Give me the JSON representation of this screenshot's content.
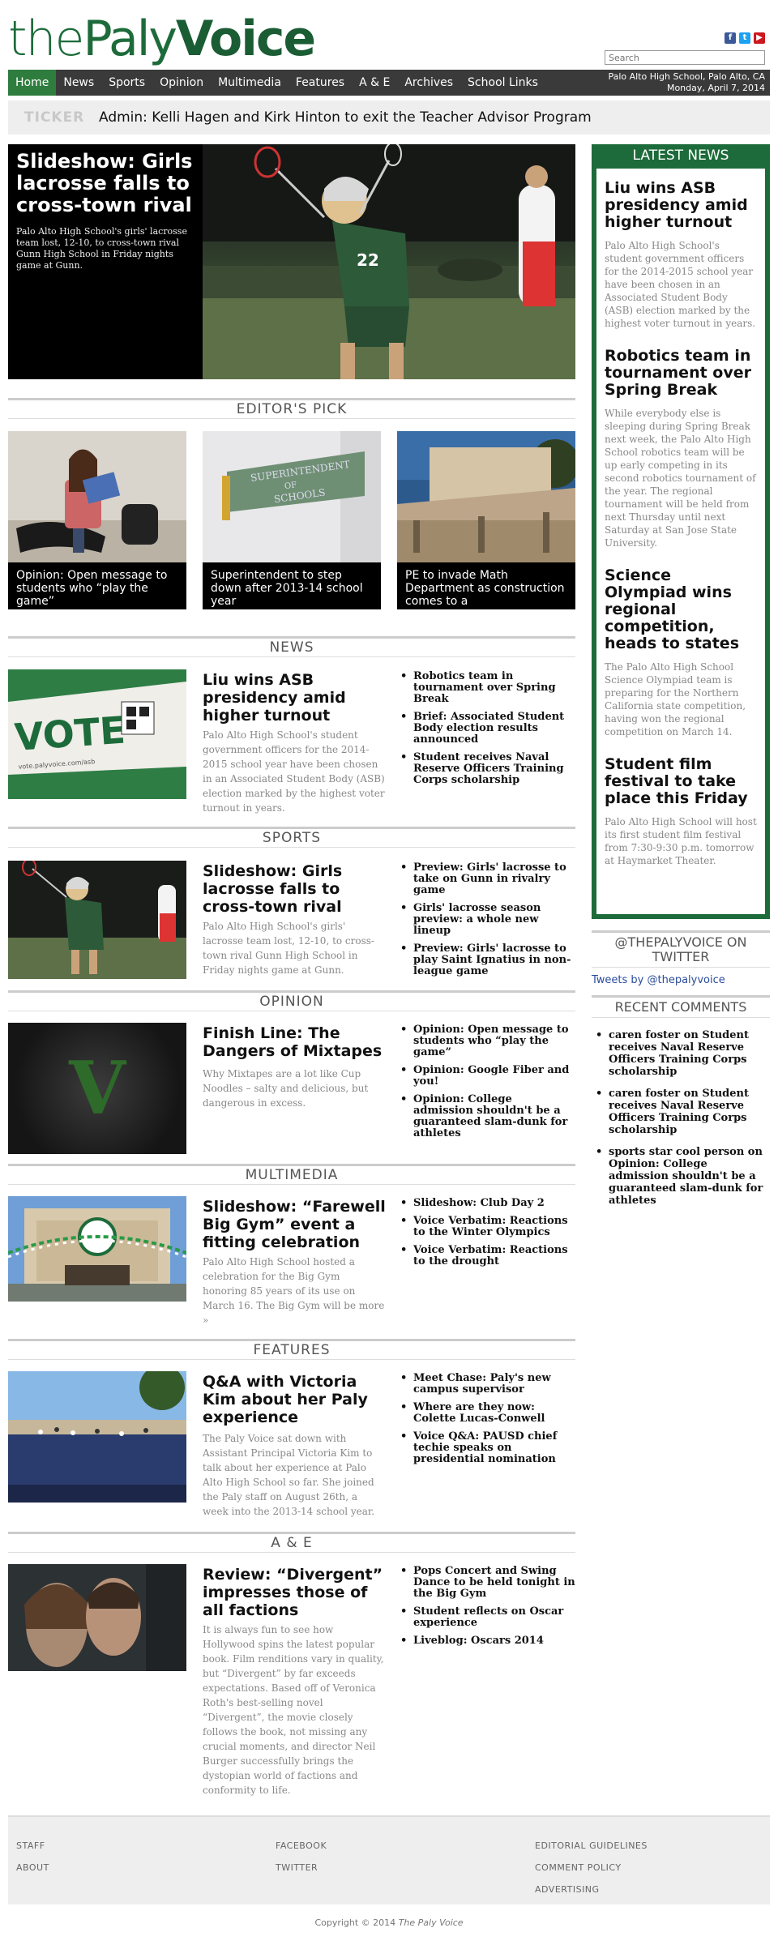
{
  "header": {
    "logo_part1": "the",
    "logo_part2": "Paly",
    "logo_part3": "Voice",
    "search_placeholder": "Search",
    "social_icons": [
      "facebook-icon",
      "twitter-icon",
      "youtube-icon"
    ]
  },
  "nav": {
    "items": [
      "Home",
      "News",
      "Sports",
      "Opinion",
      "Multimedia",
      "Features",
      "A & E",
      "Archives",
      "School Links"
    ],
    "active": "Home",
    "location": "Palo Alto High School, Palo Alto, CA",
    "date": "Monday, April 7, 2014"
  },
  "ticker": {
    "label": "TICKER",
    "text": "Admin: Kelli Hagen and Kirk Hinton to exit the Teacher Advisor Program"
  },
  "hero": {
    "title": "Slideshow: Girls lacrosse falls to cross-town rival",
    "desc": "Palo Alto High School's girls' lacrosse team lost, 12-10, to cross-town rival Gunn High School in Friday nights game at Gunn."
  },
  "editors_pick": {
    "heading": "EDITOR'S PICK",
    "items": [
      {
        "caption": "Opinion: Open message to students who “play the game”"
      },
      {
        "caption": "Superintendent to step down after 2013-14 school year",
        "sign_line1": "SUPERINTENDENT",
        "sign_line2": "OF",
        "sign_line3": "SCHOOLS"
      },
      {
        "caption": "PE to invade Math Department as construction comes to a"
      }
    ]
  },
  "news": {
    "heading": "NEWS",
    "img_text": "VOTE",
    "img_sub": "vote.palyvoice.com/asb",
    "title": "Liu wins ASB presidency amid higher turnout",
    "desc": "Palo Alto High School's student government officers for the 2014-2015 school year have been chosen in an Associated Student Body (ASB) election marked by the highest voter turnout in years.",
    "links": [
      "Robotics team in tournament over Spring Break",
      "Brief: Associated Student Body election results announced",
      "Student receives Naval Reserve Officers Training Corps scholarship"
    ]
  },
  "sports": {
    "heading": "SPORTS",
    "title": "Slideshow: Girls lacrosse falls to cross-town rival",
    "desc": "Palo Alto High School's girls' lacrosse team lost, 12-10, to cross-town rival Gunn High School in Friday nights game at Gunn.",
    "links": [
      "Preview: Girls' lacrosse to take on Gunn in rivalry game",
      "Girls' lacrosse season preview: a whole new lineup",
      "Preview: Girls' lacrosse to play Saint Ignatius in non-league game"
    ]
  },
  "opinion": {
    "heading": "OPINION",
    "img_letter": "V",
    "title": "Finish Line: The Dangers of Mixtapes",
    "desc": "Why Mixtapes are a lot like Cup Noodles – salty and delicious, but dangerous in excess.",
    "links": [
      "Opinion: Open message to students who “play the game”",
      "Opinion: Google Fiber and you!",
      "Opinion: College admission shouldn't be a guaranteed slam-dunk for athletes"
    ]
  },
  "multimedia": {
    "heading": "MULTIMEDIA",
    "title": "Slideshow: “Farewell Big Gym” event a fitting celebration",
    "desc": "Palo Alto High School hosted a celebration for the Big Gym honoring 85 years of its use on March 16. The Big Gym will be more »",
    "links": [
      "Slideshow: Club Day 2",
      "Voice Verbatim: Reactions to the Winter Olympics",
      "Voice Verbatim: Reactions to the drought"
    ]
  },
  "features": {
    "heading": "FEATURES",
    "title": "Q&A with Victoria Kim about her Paly experience",
    "desc": "The Paly Voice sat down with Assistant Principal Victoria Kim to talk about her experience at Palo Alto High School so far. She joined the Paly staff on August 26th, a week into the 2013-14 school year.",
    "links": [
      "Meet Chase: Paly's new campus supervisor",
      "Where are they now: Colette Lucas-Conwell",
      "Voice Q&A: PAUSD chief techie speaks on presidential nomination"
    ]
  },
  "ae": {
    "heading": "A & E",
    "title": "Review: “Divergent” impresses those of all factions",
    "desc": "It is always fun to see how Hollywood spins the latest popular book. Film renditions vary in quality, but “Divergent” by far exceeds expectations. Based off of Veronica Roth's best-selling novel “Divergent”, the movie closely follows the book, not missing any crucial moments, and director Neil Burger successfully brings the dystopian world of factions and conformity to life.",
    "links": [
      "Pops Concert and Swing Dance to be held tonight in the Big Gym",
      "Student reflects on Oscar experience",
      "Liveblog: Oscars 2014"
    ]
  },
  "latest": {
    "heading": "LATEST NEWS",
    "items": [
      {
        "title": "Liu wins ASB presidency amid higher turnout",
        "desc": "Palo Alto High School's student government officers for the 2014-2015 school year have been chosen in an Associated Student Body (ASB) election marked by the highest voter turnout in years."
      },
      {
        "title": "Robotics team in tournament over Spring Break",
        "desc": "While everybody else is sleeping during Spring Break next week, the Palo Alto High School robotics team will be up early competing in its second robotics tournament of the year. The regional tournament will be held from next Thursday until next Saturday at San Jose State University."
      },
      {
        "title": "Science Olympiad wins regional competition, heads to states",
        "desc": "The Palo Alto High School Science Olympiad team is preparing for the Northern California state competition, having won the regional competition on March 14."
      },
      {
        "title": "Student film festival to take place this Friday",
        "desc": "Palo Alto High School will host its first student film festival from 7:30-9:30 p.m. tomorrow at Haymarket Theater."
      }
    ]
  },
  "twitter": {
    "heading": "@THEPALYVOICE ON TWITTER",
    "link": "Tweets by @thepalyvoice"
  },
  "comments": {
    "heading": "RECENT COMMENTS",
    "items": [
      "caren foster on Student receives Naval Reserve Officers Training Corps scholarship",
      "caren foster on Student receives Naval Reserve Officers Training Corps scholarship",
      "sports star cool person on Opinion: College admission shouldn't be a guaranteed slam-dunk for athletes"
    ]
  },
  "footer": {
    "col1": [
      "STAFF",
      "ABOUT"
    ],
    "col2": [
      "FACEBOOK",
      "TWITTER"
    ],
    "col3": [
      "EDITORIAL GUIDELINES",
      "COMMENT POLICY",
      "ADVERTISING"
    ],
    "copyright": "Copyright © 2014",
    "copyright_name": "The Paly Voice"
  }
}
